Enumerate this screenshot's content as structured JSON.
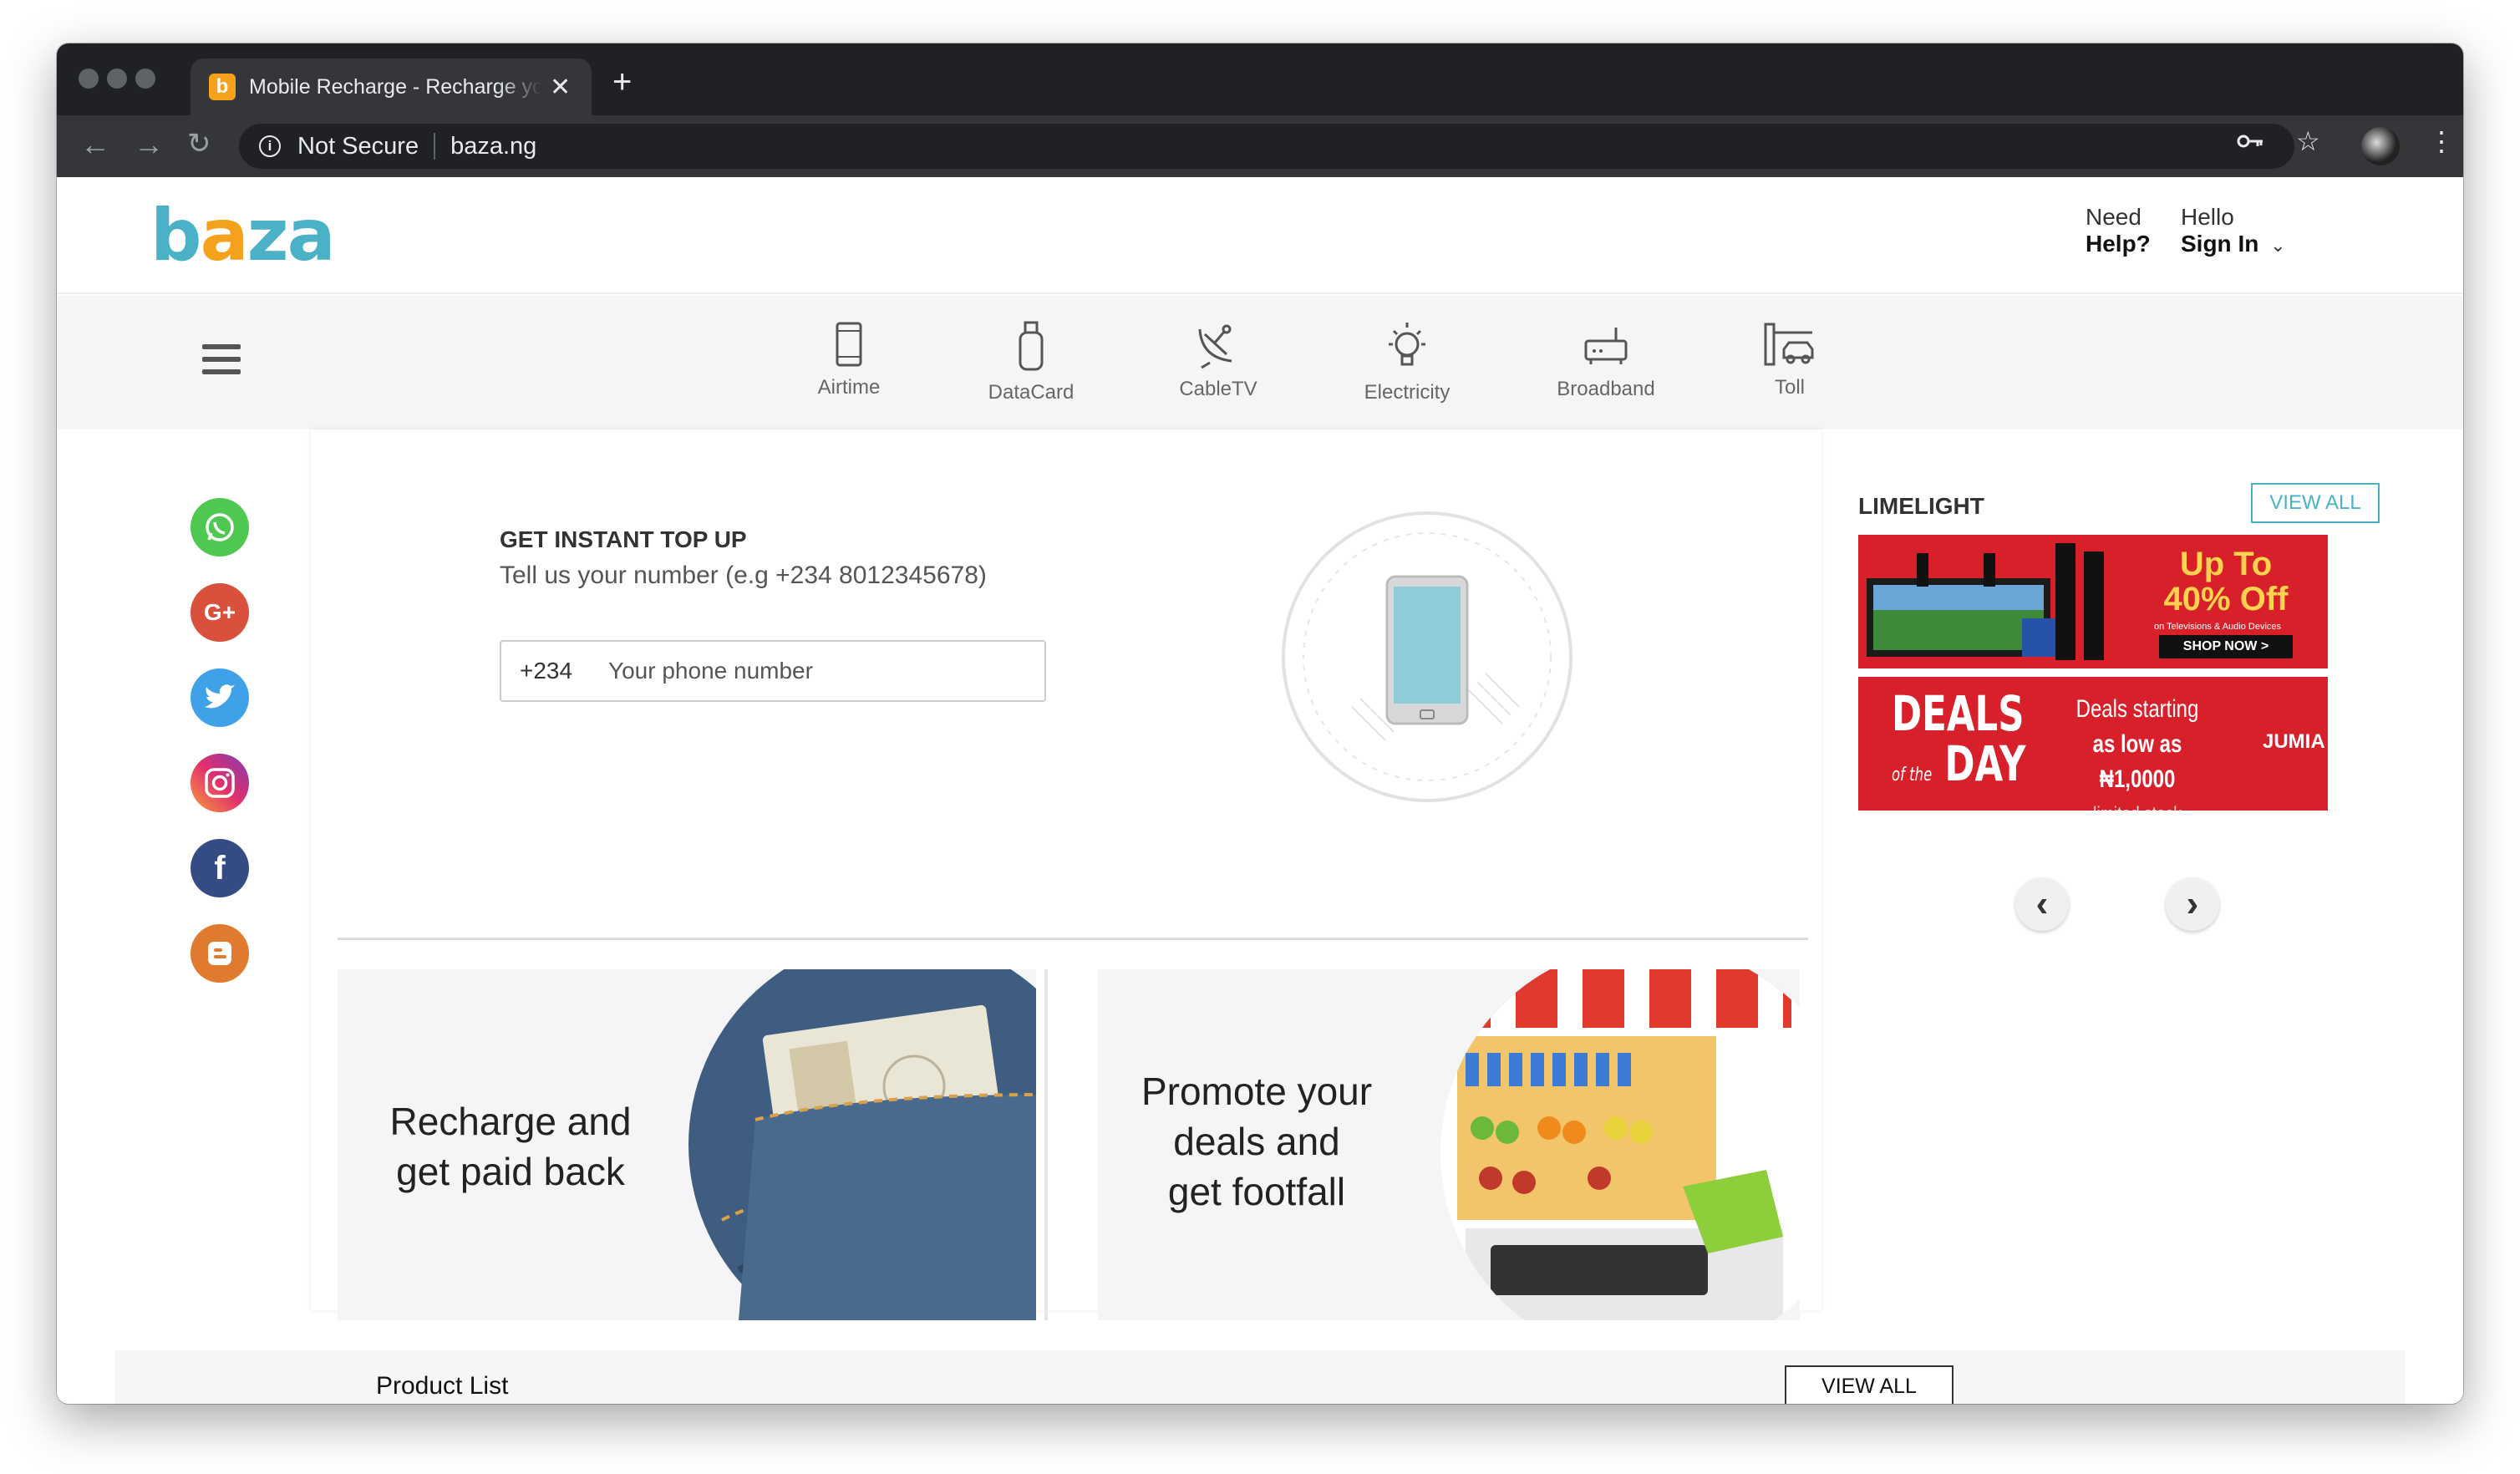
{
  "browser": {
    "tab_title": "Mobile Recharge - Recharge your",
    "favicon_letter": "b",
    "security_label": "Not Secure",
    "url": "baza.ng"
  },
  "header": {
    "logo_prefix": "b",
    "logo_a": "a",
    "logo_suffix": "za",
    "help_line1": "Need",
    "help_line2": "Help?",
    "signin_line1": "Hello",
    "signin_line2": "Sign In"
  },
  "services": [
    {
      "label": "Airtime",
      "icon": "phone-icon"
    },
    {
      "label": "DataCard",
      "icon": "usb-modem-icon"
    },
    {
      "label": "CableTV",
      "icon": "satellite-dish-icon"
    },
    {
      "label": "Electricity",
      "icon": "lightbulb-icon"
    },
    {
      "label": "Broadband",
      "icon": "router-icon"
    },
    {
      "label": "Toll",
      "icon": "toll-gate-icon"
    }
  ],
  "social": [
    {
      "name": "whatsapp",
      "glyph": "✆",
      "color": "#4ec851"
    },
    {
      "name": "google-plus",
      "glyph": "G+",
      "color": "#d9503d"
    },
    {
      "name": "twitter",
      "glyph": "t",
      "color": "#3fa2e8"
    },
    {
      "name": "instagram",
      "glyph": "◎",
      "color": "#c13584"
    },
    {
      "name": "facebook",
      "glyph": "f",
      "color": "#344b84"
    },
    {
      "name": "blogger",
      "glyph": "B",
      "color": "#e07a2e"
    }
  ],
  "topup": {
    "title": "GET INSTANT TOP UP",
    "subtitle": "Tell us your number (e.g +234 8012345678)",
    "prefix": "+234",
    "placeholder": "Your phone number"
  },
  "promos": {
    "left_line1": "Recharge and",
    "left_line2": "get paid back",
    "right_line1": "Promote your",
    "right_line2": "deals and",
    "right_line3": "get footfall"
  },
  "limelight": {
    "title": "LIMELIGHT",
    "view_all": "VIEW ALL",
    "banner1_line1": "Up To",
    "banner1_line2": "40% Off",
    "banner1_small": "on Televisions & Audio Devices",
    "banner1_cta": "SHOP NOW >",
    "banner2_deals": "DEALS",
    "banner2_of_the": "of the",
    "banner2_day": "DAY",
    "banner2_line1": "Deals starting",
    "banner2_line2": "as low as ₦1,0000",
    "banner2_line3": "limited stock",
    "banner2_brand": "JUMIA"
  },
  "footer": {
    "product_list": "Product List",
    "view_all": "VIEW ALL"
  },
  "colors": {
    "brand_teal": "#4bb1c7",
    "brand_orange": "#f4a21c",
    "banner_red": "#d7202a"
  }
}
